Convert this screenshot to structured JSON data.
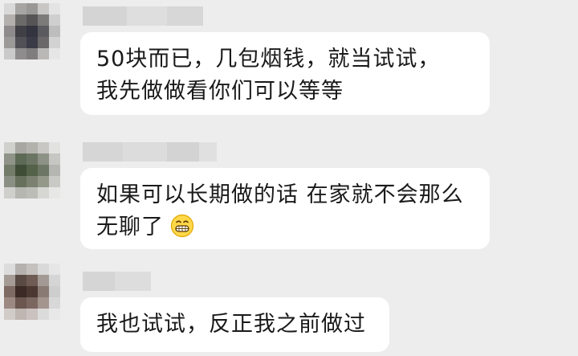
{
  "chat": {
    "messages": [
      {
        "lines": [
          "50块而已，几包烟钱，就当试试，",
          "我先做做看你们可以等等"
        ]
      },
      {
        "lines": [
          "如果可以长期做的话 在家就不会那么",
          "无聊了"
        ],
        "emoji": "grinning-face-emoji"
      },
      {
        "lines": [
          "我也试试，反正我之前做过"
        ]
      }
    ]
  },
  "colors": {
    "background": "#ededed",
    "bubble": "#ffffff",
    "text": "#1a1a1a",
    "blurred_name": "#d8d8d8"
  }
}
